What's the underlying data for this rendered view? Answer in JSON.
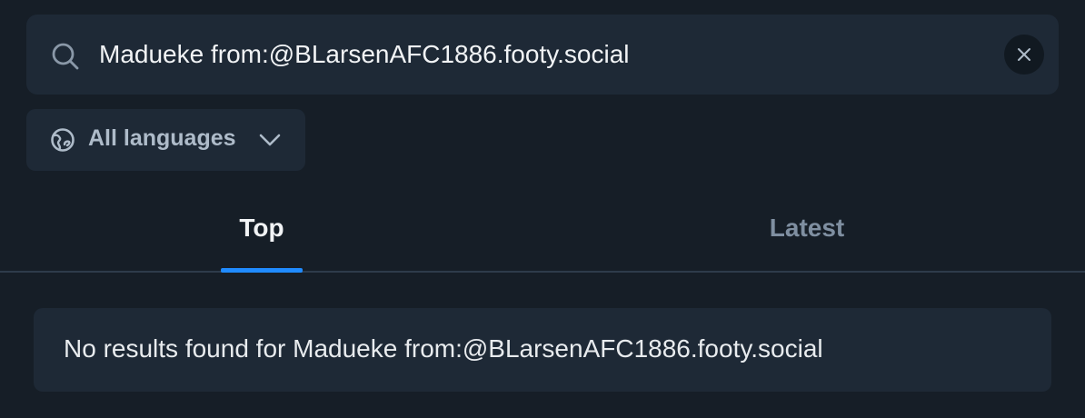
{
  "search": {
    "value": "Madueke from:@BLarsenAFC1886.footy.social",
    "icon": "search-icon",
    "clear_icon": "close-icon"
  },
  "language_filter": {
    "label": "All languages",
    "icon": "globe-icon",
    "dropdown_icon": "chevron-down-icon"
  },
  "tabs": [
    {
      "label": "Top",
      "active": true
    },
    {
      "label": "Latest",
      "active": false
    }
  ],
  "results": {
    "empty_message": "No results found for Madueke from:@BLarsenAFC1886.footy.social"
  },
  "colors": {
    "background": "#161e27",
    "surface": "#1e2936",
    "accent": "#208bfe",
    "text_primary": "#f1f3f5",
    "text_muted": "#7f8fa1"
  }
}
